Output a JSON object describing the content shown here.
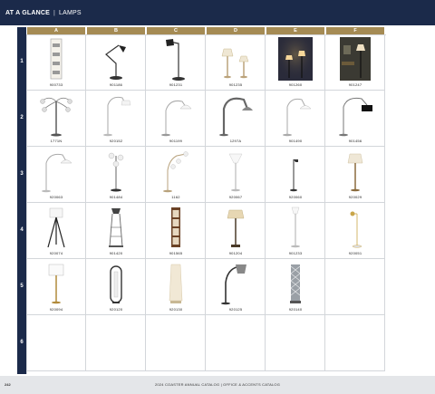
{
  "header": {
    "section": "AT A GLANCE",
    "topic": "LAMPS"
  },
  "columns": [
    "A",
    "B",
    "C",
    "D",
    "E",
    "F"
  ],
  "rows": [
    "1",
    "2",
    "3",
    "4",
    "5",
    "6"
  ],
  "products": [
    [
      "900733",
      "901186",
      "901231",
      "901235",
      "901260",
      "901247"
    ],
    [
      "1771N",
      "920152",
      "901199",
      "1297A",
      "901490",
      "901456"
    ],
    [
      "920063",
      "901484",
      "1162",
      "920067",
      "920060",
      "920029"
    ],
    [
      "920074",
      "901420",
      "901565",
      "901204",
      "901233",
      "920051"
    ],
    [
      "920094",
      "920120",
      "920130",
      "920125",
      "920140",
      ""
    ],
    [
      "",
      "",
      "",
      "",
      "",
      ""
    ]
  ],
  "footer": {
    "page_number": "242",
    "catalog": "2024 COASTER ANNUAL CATALOG  |  OFFICE & ACCENTS CATALOG"
  },
  "colors": {
    "navy": "#1b2a4a",
    "gold": "#a58b54",
    "grid": "#d3d6da"
  }
}
